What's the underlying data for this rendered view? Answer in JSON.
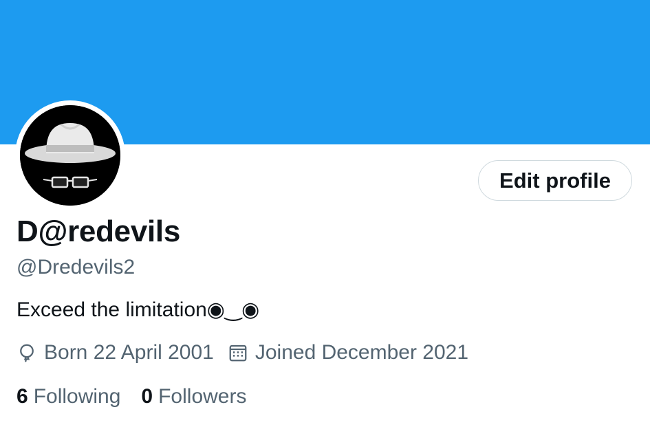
{
  "profile": {
    "display_name": "D@redevils",
    "handle": "@Dredevils2",
    "bio": "Exceed the limitation◉‿◉",
    "birthday": "Born 22 April 2001",
    "joined": "Joined December 2021",
    "edit_button": "Edit profile"
  },
  "stats": {
    "following_count": "6",
    "following_label": "Following",
    "followers_count": "0",
    "followers_label": "Followers"
  },
  "colors": {
    "banner": "#1d9bf0",
    "primary_text": "#0f1419",
    "secondary_text": "#536471",
    "button_border": "#cfd9de"
  },
  "icons": {
    "birthday": "balloon-icon",
    "joined": "calendar-icon"
  }
}
